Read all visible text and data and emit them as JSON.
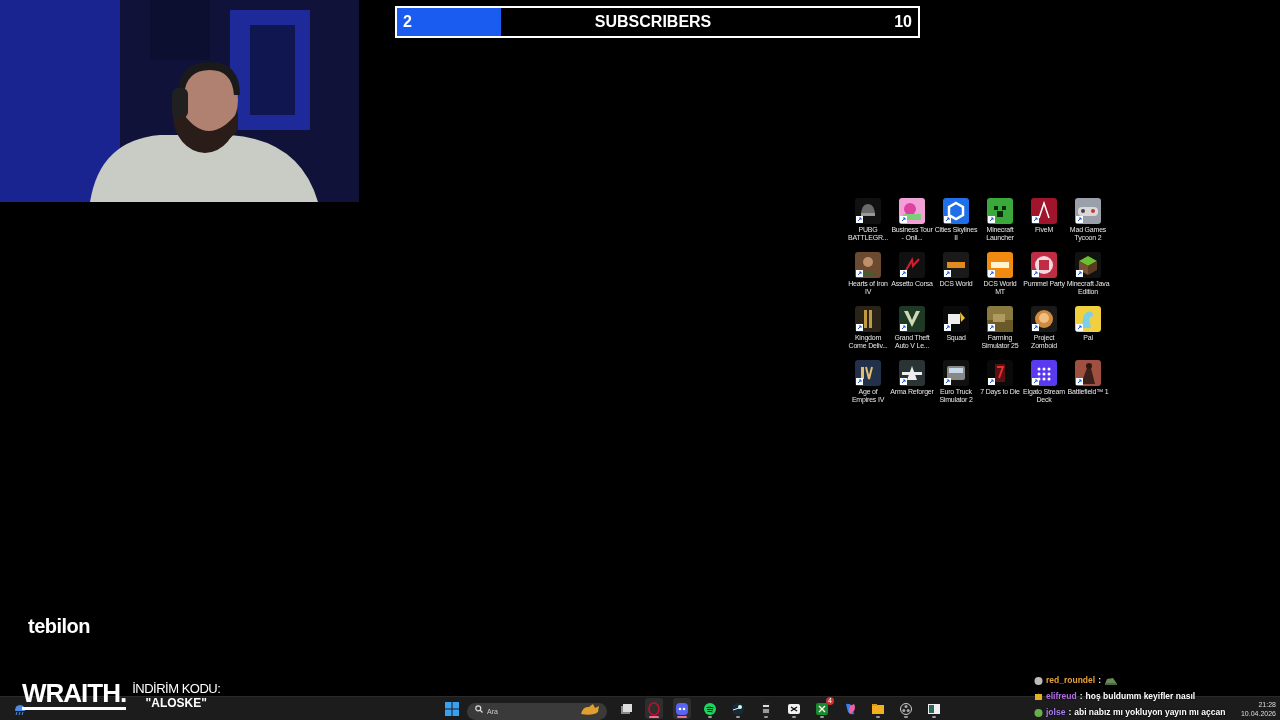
{
  "subscriber_goal": {
    "current": "2",
    "label": "SUBSCRIBERS",
    "target": "10",
    "level": 0.2
  },
  "desktop_icons": [
    {
      "label": "PUBG BATTLEGR..."
    },
    {
      "label": "Business Tour - Onli..."
    },
    {
      "label": "Cities Skylines II"
    },
    {
      "label": "Minecraft Launcher"
    },
    {
      "label": "FiveM"
    },
    {
      "label": "Mad Games Tycoon 2"
    },
    {
      "label": "Hearts of Iron IV"
    },
    {
      "label": "Assetto Corsa"
    },
    {
      "label": "DCS World"
    },
    {
      "label": "DCS World MT"
    },
    {
      "label": "Pummel Party"
    },
    {
      "label": "Minecraft Java Edition"
    },
    {
      "label": "Kingdom Come Deliv..."
    },
    {
      "label": "Grand Theft Auto V Le..."
    },
    {
      "label": "Squad"
    },
    {
      "label": "Farming Simulator 25"
    },
    {
      "label": "Project Zomboid"
    },
    {
      "label": "Pal"
    },
    {
      "label": "Age of Empires IV"
    },
    {
      "label": "Arma Reforger"
    },
    {
      "label": "Euro Truck Simulator 2"
    },
    {
      "label": "7 Days to Die"
    },
    {
      "label": "Elgato Stream Deck"
    },
    {
      "label": "Battlefield™ 1"
    }
  ],
  "sponsors": {
    "logo": "tebilon",
    "brand": "WRAITH.",
    "promo_label": "İNDİRİM KODU:",
    "promo_code": "\"ALOSKE\""
  },
  "chat": [
    {
      "kind": "emote",
      "user": "red_roundel",
      "separator": ":",
      "color": "#e8a23a"
    },
    {
      "kind": "text",
      "user": "elifreud",
      "separator": ":",
      "color": "#b46ee6",
      "message": "hoş buldumm keyifler nasıl"
    },
    {
      "kind": "text",
      "user": "jolse",
      "separator": ":",
      "color": "#a77ff0",
      "message": "abi nabız mı yokluyon yayın mı açcan"
    }
  ],
  "taskbar": {
    "search": {
      "placeholder": "Ara"
    },
    "apps": [
      {
        "open": false,
        "active": false
      },
      {
        "open": true,
        "active": true
      },
      {
        "open": true,
        "active": true
      },
      {
        "open": true,
        "active": false
      },
      {
        "open": true,
        "active": false
      },
      {
        "open": true,
        "active": false
      },
      {
        "open": true,
        "active": false
      },
      {
        "open": true,
        "active": false,
        "badge": "4"
      },
      {
        "open": false,
        "active": false
      },
      {
        "open": true,
        "active": false
      },
      {
        "open": true,
        "active": false
      },
      {
        "open": true,
        "active": false
      }
    ],
    "time": "21:28",
    "date": "10.04.2026"
  }
}
